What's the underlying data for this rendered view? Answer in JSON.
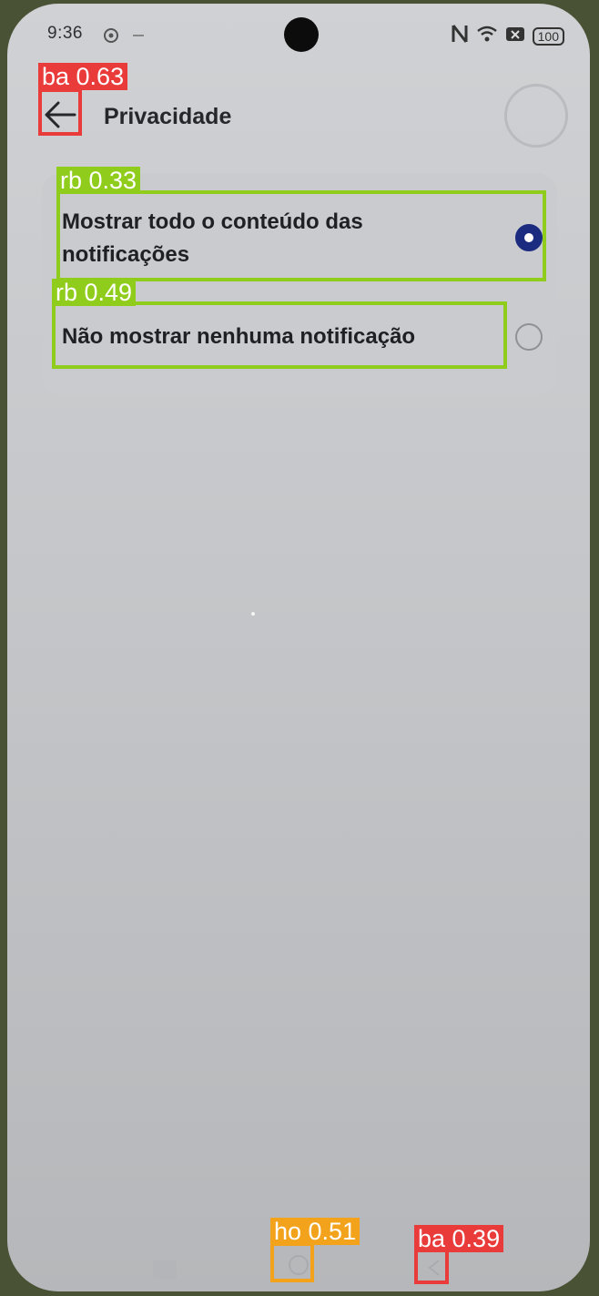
{
  "status_bar": {
    "time": "9:36",
    "battery": "100",
    "icons": [
      "nfc-icon",
      "wifi-icon",
      "signal-off-icon",
      "battery-icon"
    ]
  },
  "header": {
    "title": "Privacidade",
    "back_icon": "arrow-left-icon"
  },
  "options": [
    {
      "label_line1": "Mostrar todo o conteúdo das",
      "label_line2": "notificações",
      "selected": true
    },
    {
      "label_line1": "Não mostrar nenhuma notificação",
      "selected": false
    }
  ],
  "detections": [
    {
      "label": "ba 0.63",
      "color": "#ea3b3b"
    },
    {
      "label": "rb 0.33",
      "color": "#8fcc1c"
    },
    {
      "label": "rb 0.49",
      "color": "#8fcc1c"
    },
    {
      "label": "ho 0.51",
      "color": "#f3a21c"
    },
    {
      "label": "ba 0.39",
      "color": "#ea3b3b"
    }
  ],
  "colors": {
    "accent": "#1b2b7f",
    "background": "#c8cacd"
  }
}
